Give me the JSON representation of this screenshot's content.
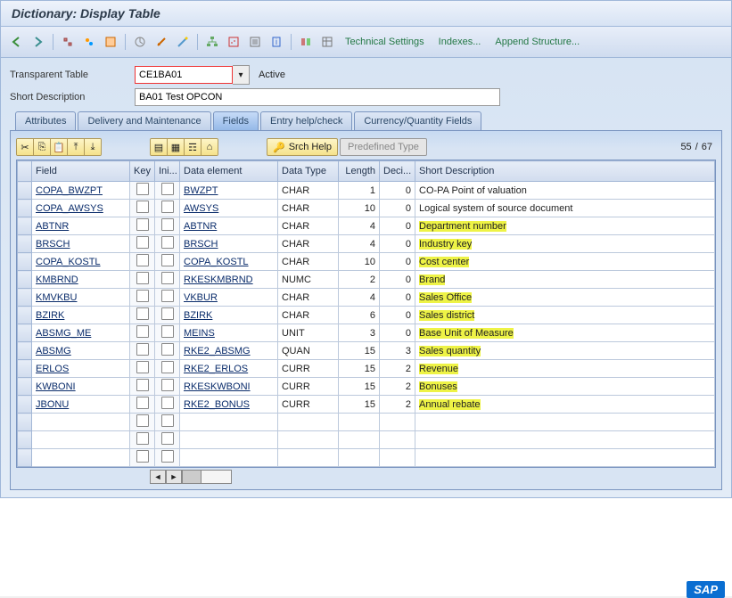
{
  "window": {
    "title": "Dictionary: Display Table"
  },
  "header": {
    "table_label": "Transparent Table",
    "table_value": "CE1BA01",
    "status": "Active",
    "short_desc_label": "Short Description",
    "short_desc_value": "BA01 Test OPCON"
  },
  "txtbuttons": {
    "tech": "Technical Settings",
    "idx": "Indexes...",
    "append": "Append Structure..."
  },
  "tabs": {
    "attributes": "Attributes",
    "delivery": "Delivery and Maintenance",
    "fields": "Fields",
    "entry": "Entry help/check",
    "currency": "Currency/Quantity Fields"
  },
  "minibar": {
    "srch_help": "Srch Help",
    "predef": "Predefined Type",
    "row_current": "55",
    "row_sep": "/",
    "row_total": "67"
  },
  "cols": {
    "field": "Field",
    "key": "Key",
    "init": "Ini...",
    "elem": "Data element",
    "type": "Data Type",
    "len": "Length",
    "dec": "Deci...",
    "sdesc": "Short Description"
  },
  "rows": [
    {
      "field": "COPA_BWZPT",
      "elem": "BWZPT",
      "type": "CHAR",
      "len": "1",
      "dec": "0",
      "sdesc": "CO-PA Point of valuation",
      "hl": false
    },
    {
      "field": "COPA_AWSYS",
      "elem": "AWSYS",
      "type": "CHAR",
      "len": "10",
      "dec": "0",
      "sdesc": "Logical system of source document",
      "hl": false
    },
    {
      "field": "ABTNR",
      "elem": "ABTNR",
      "type": "CHAR",
      "len": "4",
      "dec": "0",
      "sdesc": "Department number",
      "hl": true
    },
    {
      "field": "BRSCH",
      "elem": "BRSCH",
      "type": "CHAR",
      "len": "4",
      "dec": "0",
      "sdesc": "Industry key",
      "hl": true
    },
    {
      "field": "COPA_KOSTL",
      "elem": "COPA_KOSTL",
      "type": "CHAR",
      "len": "10",
      "dec": "0",
      "sdesc": "Cost center",
      "hl": true
    },
    {
      "field": "KMBRND",
      "elem": "RKESKMBRND",
      "type": "NUMC",
      "len": "2",
      "dec": "0",
      "sdesc": "Brand",
      "hl": true
    },
    {
      "field": "KMVKBU",
      "elem": "VKBUR",
      "type": "CHAR",
      "len": "4",
      "dec": "0",
      "sdesc": "Sales Office",
      "hl": true
    },
    {
      "field": "BZIRK",
      "elem": "BZIRK",
      "type": "CHAR",
      "len": "6",
      "dec": "0",
      "sdesc": "Sales district",
      "hl": true
    },
    {
      "field": "ABSMG_ME",
      "elem": "MEINS",
      "type": "UNIT",
      "len": "3",
      "dec": "0",
      "sdesc": "Base Unit of Measure",
      "hl": true
    },
    {
      "field": "ABSMG",
      "elem": "RKE2_ABSMG",
      "type": "QUAN",
      "len": "15",
      "dec": "3",
      "sdesc": "Sales quantity",
      "hl": true
    },
    {
      "field": "ERLOS",
      "elem": "RKE2_ERLOS",
      "type": "CURR",
      "len": "15",
      "dec": "2",
      "sdesc": "Revenue",
      "hl": true
    },
    {
      "field": "KWBONI",
      "elem": "RKESKWBONI",
      "type": "CURR",
      "len": "15",
      "dec": "2",
      "sdesc": "Bonuses",
      "hl": true
    },
    {
      "field": "JBONU",
      "elem": "RKE2_BONUS",
      "type": "CURR",
      "len": "15",
      "dec": "2",
      "sdesc": "Annual rebate",
      "hl": true
    }
  ],
  "blank_rows": 3,
  "logo": "SAP"
}
